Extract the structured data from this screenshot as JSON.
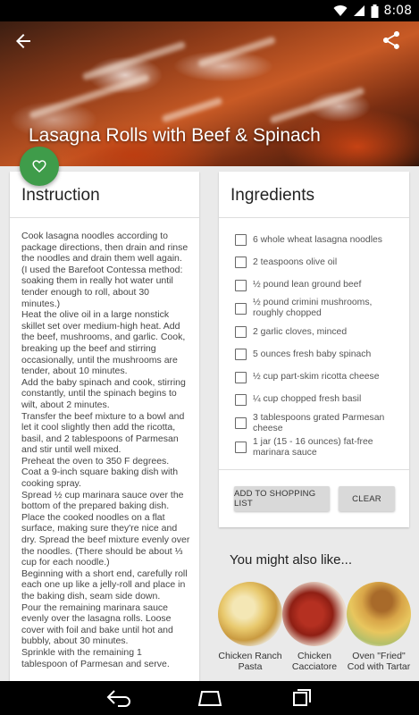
{
  "status_bar": {
    "time": "8:08"
  },
  "recipe": {
    "title": "Lasagna Rolls with Beef & Spinach"
  },
  "instructions": {
    "header": "Instruction",
    "paragraphs": [
      "Cook lasagna noodles according to package directions, then drain and rinse the noodles and drain them well again. (I used the Barefoot Contessa method: soaking them in really hot water until tender enough to roll, about 30 minutes.)",
      "Heat the olive oil in a large nonstick skillet set over medium-high heat. Add the beef, mushrooms, and garlic. Cook, breaking up the beef and stirring occasionally, until the mushrooms are tender, about 10 minutes.",
      "Add the baby spinach and cook, stirring constantly, until the spinach begins to wilt, about 2 minutes.",
      "Transfer the beef mixture to a bowl and let it cool slightly then add the ricotta, basil, and 2 tablespoons of Parmesan and stir until well mixed.",
      "Preheat the oven to 350 F degrees.",
      "Coat a 9-inch square baking dish with cooking spray.",
      "Spread ½ cup marinara sauce over the bottom of the prepared baking dish.",
      "Place the cooked noodles on a flat surface, making sure they're nice and dry. Spread the beef mixture evenly over the noodles. (There should be about ⅓ cup for each noodle.)",
      "Beginning with a short end, carefully roll each one up like a jelly-roll and place in the baking dish, seam side down.",
      "Pour the remaining marinara sauce evenly over the lasagna rolls. Loose cover with foil and bake until hot and bubbly, about 30 minutes.",
      "Sprinkle with the remaining 1 tablespoon of Parmesan and serve."
    ]
  },
  "ingredients": {
    "header": "Ingredients",
    "items": [
      "6 whole wheat lasagna noodles",
      "2 teaspoons olive oil",
      "½ pound lean ground beef",
      "½ pound crimini mushrooms, roughly chopped",
      "2 garlic cloves, minced",
      "5 ounces fresh baby spinach",
      "½ cup part-skim ricotta cheese",
      "¼ cup chopped fresh basil",
      "3 tablespoons grated Parmesan cheese",
      "1 jar (15 - 16 ounces) fat-free marinara sauce"
    ],
    "add_button": "ADD TO SHOPPING LIST",
    "clear_button": "CLEAR"
  },
  "suggestions": {
    "title": "You might also like...",
    "items": [
      {
        "line1": "Chicken Ranch",
        "line2": "Pasta"
      },
      {
        "line1": "Chicken",
        "line2": "Cacciatore"
      },
      {
        "line1": "Oven \"Fried\"",
        "line2": "Cod with Tartar"
      }
    ]
  },
  "colors": {
    "fab": "#3f9c4a",
    "card": "#ffffff",
    "background": "#eaeaea"
  }
}
